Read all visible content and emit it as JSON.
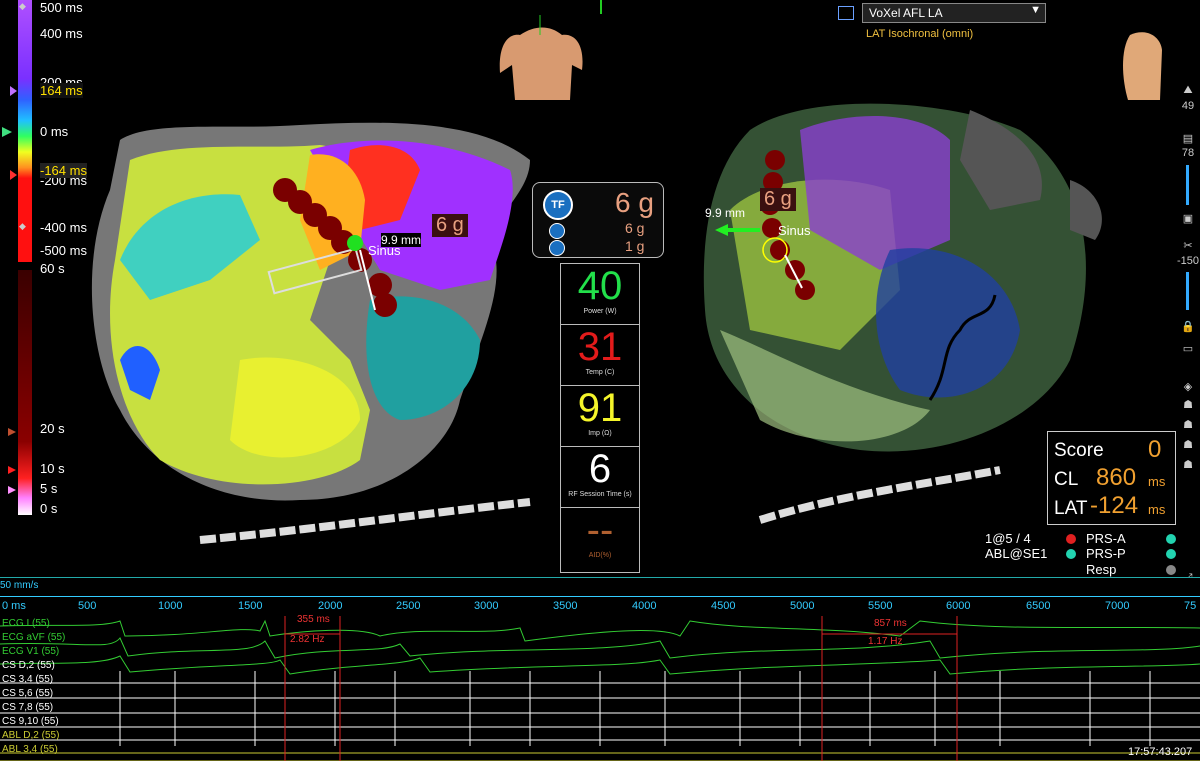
{
  "colors": {
    "accent_cyan": "#22d3ee",
    "power": "#22e04a",
    "temp": "#e31b1b",
    "imp": "#f5f52a",
    "session": "#ffffff",
    "aid": "#b06030",
    "score": "#f0a030"
  },
  "lat_scale": {
    "ticks": [
      "500 ms",
      "400 ms",
      "200 ms",
      "0 ms",
      "-200 ms",
      "-400 ms",
      "-500 ms"
    ],
    "marker_high": "164 ms",
    "marker_low": "-164 ms"
  },
  "time_scale": {
    "ticks": [
      "60 s",
      "20 s",
      "10 s",
      "5 s",
      "0 s"
    ]
  },
  "left_map": {
    "distance": "9.9 mm",
    "force": "6 g",
    "sinus": "Sinus"
  },
  "right_map": {
    "distance": "9.9 mm",
    "force": "6 g",
    "sinus": "Sinus"
  },
  "dropdown": {
    "value": "VoXel AFL LA",
    "subtitle": "LAT Isochronal (omni)"
  },
  "tf_box": {
    "logo": "TF",
    "force_total": "6 g",
    "force_a": "6 g",
    "force_b": "1 g"
  },
  "metrics": [
    {
      "value": "40",
      "caption": "Power (W)"
    },
    {
      "value": "31",
      "caption": "Temp (C)"
    },
    {
      "value": "91",
      "caption": "Imp (Ω)"
    },
    {
      "value": "6",
      "caption": "RF Session Time (s)"
    },
    {
      "value": "--",
      "caption": "AID(%)"
    }
  ],
  "score": {
    "score_label": "Score",
    "score_value": "0",
    "cl_label": "CL",
    "cl_value": "860",
    "cl_unit": "ms",
    "lat_label": "LAT",
    "lat_value": "-124",
    "lat_unit": "ms"
  },
  "status": {
    "line1": "1@5 / 4",
    "line2": "ABL@SE1",
    "prs_a": "PRS-A",
    "prs_p": "PRS-P",
    "resp": "Resp"
  },
  "right_toolbar": {
    "val1": "49",
    "val2": "78",
    "val3": "-150"
  },
  "ecg": {
    "speed": "50 mm/s",
    "ticks": [
      "0 ms",
      "500",
      "1000",
      "1500",
      "2000",
      "2500",
      "3000",
      "3500",
      "4000",
      "4500",
      "5000",
      "5500",
      "6000",
      "6500",
      "7000",
      "75"
    ],
    "traces": [
      "ECG I (55)",
      "ECG aVF (55)",
      "ECG V1 (55)",
      "CS D,2 (55)",
      "CS 3,4 (55)",
      "CS 5,6 (55)",
      "CS 7,8 (55)",
      "CS 9,10 (55)",
      "ABL D,2 (55)",
      "ABL 3,4 (55)"
    ],
    "caliper1_ms": "355 ms",
    "caliper1_hz": "2.82 Hz",
    "caliper2_ms": "857 ms",
    "caliper2_hz": "1.17 Hz",
    "clock": "17:57:43.207"
  }
}
